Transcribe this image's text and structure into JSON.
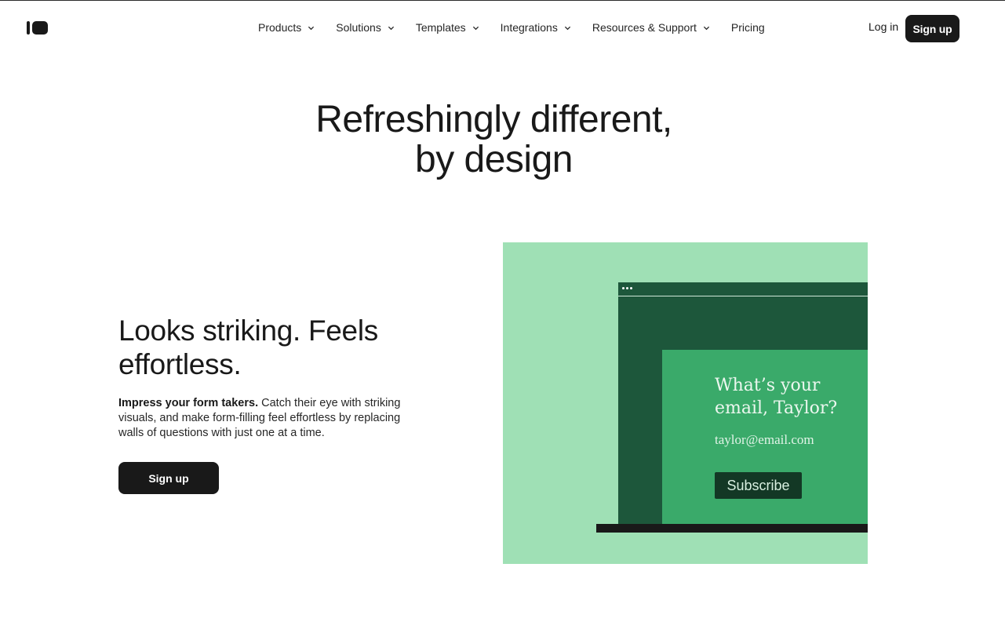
{
  "header": {
    "nav": [
      {
        "label": "Products",
        "dropdown": true
      },
      {
        "label": "Solutions",
        "dropdown": true
      },
      {
        "label": "Templates",
        "dropdown": true
      },
      {
        "label": "Integrations",
        "dropdown": true
      },
      {
        "label": "Resources & Support",
        "dropdown": true
      },
      {
        "label": "Pricing",
        "dropdown": false
      }
    ],
    "login_label": "Log in",
    "signup_label": "Sign up"
  },
  "hero": {
    "title_line1": "Refreshingly different,",
    "title_line2": "by design"
  },
  "feature": {
    "heading": "Looks striking. Feels effortless.",
    "text_bold": "Impress your form takers.",
    "text_rest": " Catch their eye with striking visuals, and make form-filling feel effortless by replacing walls of questions with just one at a time.",
    "cta_label": "Sign up"
  },
  "illustration": {
    "question": "What’s your email, Taylor?",
    "email_value": "taylor@email.com",
    "button_label": "Subscribe"
  },
  "colors": {
    "dark": "#191919",
    "illus_bg": "#9fe0b5",
    "window": "#1d573b",
    "card": "#3aaa6a",
    "button_dark": "#133825"
  }
}
